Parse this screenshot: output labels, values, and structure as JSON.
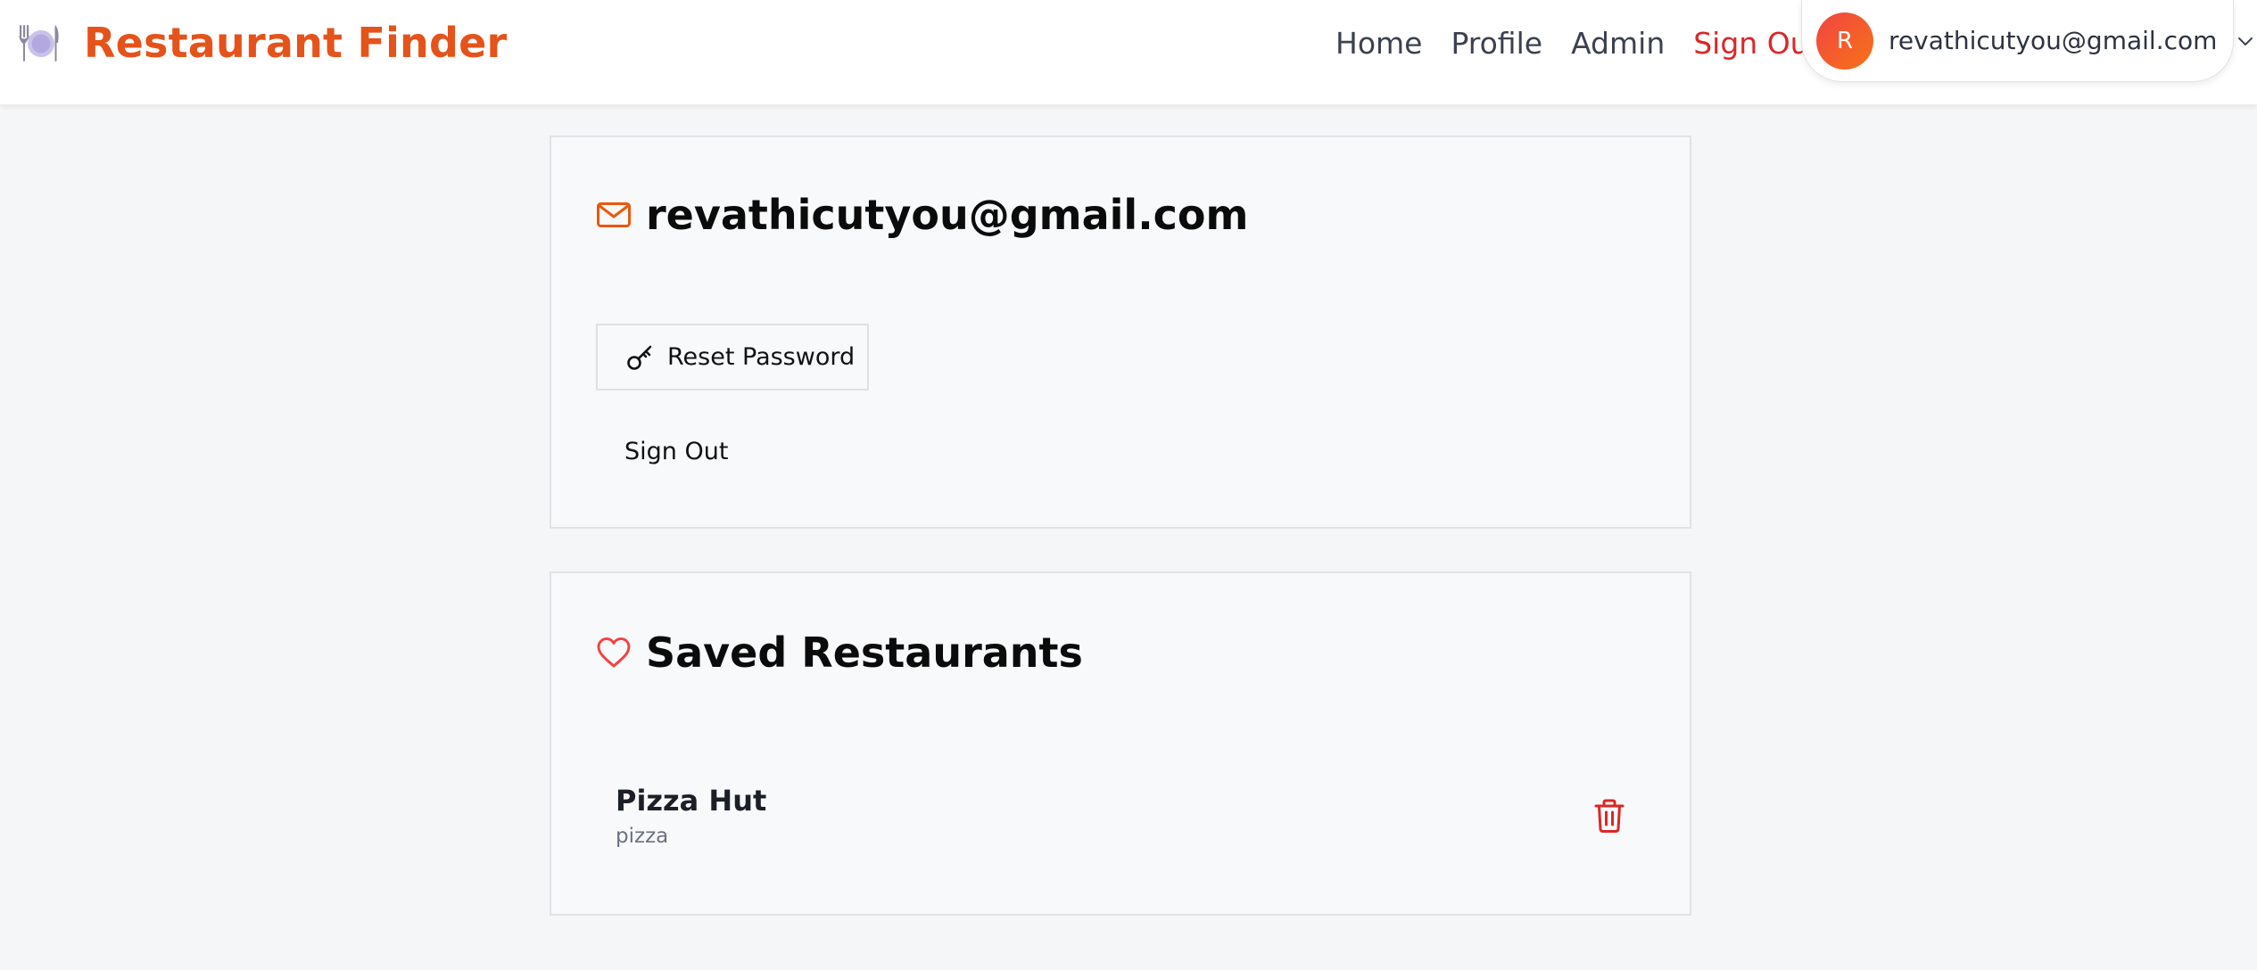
{
  "app": {
    "title": "Restaurant Finder",
    "logo_icon": "plate-cutlery-icon",
    "brand_color": "#e5531a"
  },
  "nav": {
    "links": [
      {
        "label": "Home"
      },
      {
        "label": "Profile"
      },
      {
        "label": "Admin"
      },
      {
        "label": "Sign Out",
        "color": "#dc2626"
      }
    ]
  },
  "user_menu": {
    "avatar_initial": "R",
    "email": "revathicutyou@gmail.com",
    "dropdown_icon": "chevron-down-icon"
  },
  "profile_card": {
    "email_icon": "envelope-icon",
    "email": "revathicutyou@gmail.com",
    "reset_password_label": "Reset Password",
    "reset_icon": "key-icon",
    "sign_out_label": "Sign Out"
  },
  "saved_card": {
    "icon": "heart-icon",
    "title": "Saved Restaurants",
    "restaurants": [
      {
        "name": "Pizza Hut",
        "cuisine": "pizza",
        "delete_icon": "trash-icon"
      }
    ]
  },
  "colors": {
    "accent_orange": "#e5531a",
    "danger_red": "#dc2626",
    "page_background": "#f5f6f7"
  }
}
